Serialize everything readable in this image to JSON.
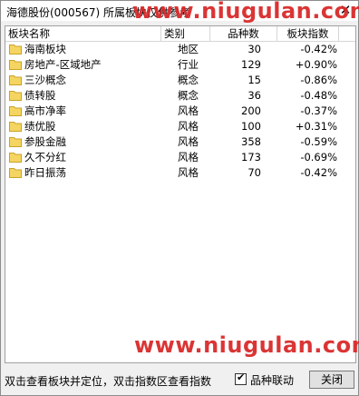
{
  "window": {
    "title": "海德股份(000567) 所属板块仅供参考",
    "watermark": "www.niugulan.com"
  },
  "table": {
    "columns": [
      "板块名称",
      "类别",
      "品种数",
      "板块指数"
    ],
    "rows": [
      {
        "name": "海南板块",
        "type": "地区",
        "count": "30",
        "change": "-0.42%"
      },
      {
        "name": "房地产-区域地产",
        "type": "行业",
        "count": "129",
        "change": "+0.90%"
      },
      {
        "name": "三沙概念",
        "type": "概念",
        "count": "15",
        "change": "-0.86%"
      },
      {
        "name": "债转股",
        "type": "概念",
        "count": "36",
        "change": "-0.48%"
      },
      {
        "name": "高市净率",
        "type": "风格",
        "count": "200",
        "change": "-0.37%"
      },
      {
        "name": "绩优股",
        "type": "风格",
        "count": "100",
        "change": "+0.31%"
      },
      {
        "name": "参股金融",
        "type": "风格",
        "count": "358",
        "change": "-0.59%"
      },
      {
        "name": "久不分红",
        "type": "风格",
        "count": "173",
        "change": "-0.69%"
      },
      {
        "name": "昨日振荡",
        "type": "风格",
        "count": "70",
        "change": "-0.42%"
      }
    ]
  },
  "footer": {
    "hint": "双击查看板块并定位，双击指数区查看指数",
    "checkbox_label": "品种联动",
    "checkbox_checked": true,
    "close_label": "关闭"
  },
  "colors": {
    "folder": "#f5d561",
    "folder_border": "#c9a227",
    "watermark": "#d92b2b"
  }
}
